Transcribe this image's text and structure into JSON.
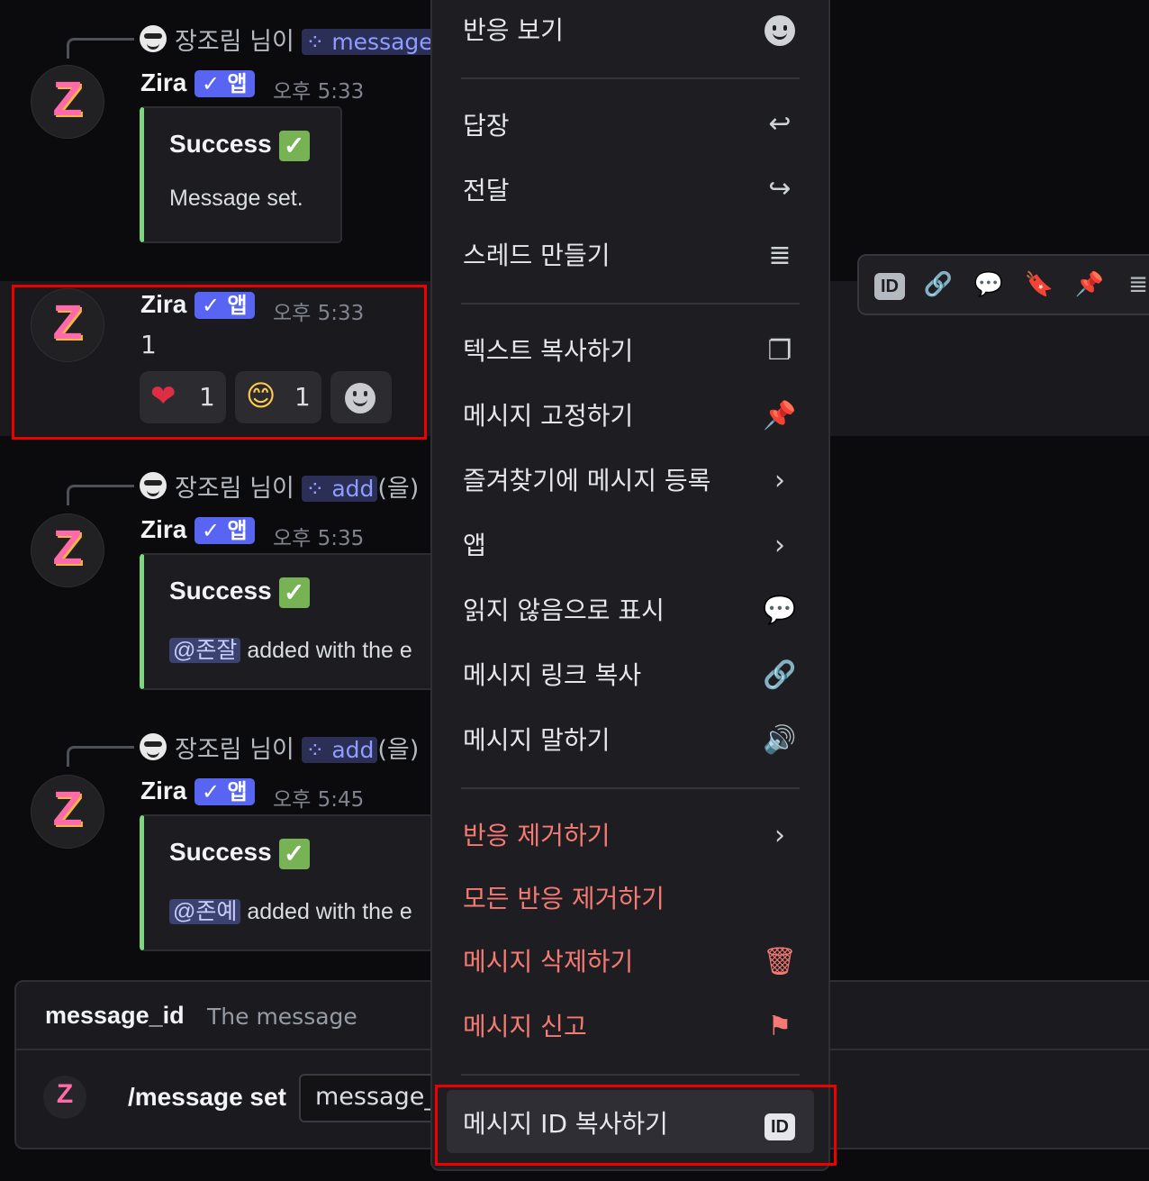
{
  "messages": [
    {
      "reply_user": "장조림",
      "reply_suffix": "님이",
      "reply_command": "message",
      "reply_tail": "",
      "author": "Zira",
      "app_badge": "앱",
      "time": "오후 5:33",
      "embed_title": "Success",
      "embed_desc": "Message set."
    },
    {
      "author": "Zira",
      "app_badge": "앱",
      "time": "오후 5:33",
      "content": "1",
      "reactions": [
        {
          "emoji": "❤",
          "count": "1"
        },
        {
          "emoji": "😊",
          "count": "1"
        }
      ]
    },
    {
      "reply_user": "장조림",
      "reply_suffix": "님이",
      "reply_command": "add",
      "reply_tail": "(을)",
      "author": "Zira",
      "app_badge": "앱",
      "time": "오후 5:35",
      "embed_title": "Success",
      "mention": "@존잘",
      "embed_desc": "added with the e"
    },
    {
      "reply_user": "장조림",
      "reply_suffix": "님이",
      "reply_command": "add",
      "reply_tail": "(을)",
      "author": "Zira",
      "app_badge": "앱",
      "time": "오후 5:45",
      "embed_title": "Success",
      "mention": "@존예",
      "embed_desc": "added with the e"
    }
  ],
  "slash": {
    "option_name": "message_id",
    "option_desc": "The message",
    "command": "/message set",
    "input_value": "message_"
  },
  "toolbar": {
    "icons": [
      "id-icon",
      "link-icon",
      "mark-unread-icon",
      "bookmark-icon",
      "pin-icon",
      "thread-icon"
    ],
    "id_label": "ID"
  },
  "menu": {
    "view_reactions": "반응 보기",
    "reply": "답장",
    "forward": "전달",
    "create_thread": "스레드 만들기",
    "copy_text": "텍스트 복사하기",
    "pin_message": "메시지 고정하기",
    "bookmark": "즐겨찾기에 메시지 등록",
    "apps": "앱",
    "mark_unread": "읽지 않음으로 표시",
    "copy_link": "메시지 링크 복사",
    "speak_message": "메시지 말하기",
    "remove_reaction": "반응 제거하기",
    "remove_all_reactions": "모든 반응 제거하기",
    "delete_message": "메시지 삭제하기",
    "report_message": "메시지 신고",
    "copy_id": "메시지 ID 복사하기",
    "id_label": "ID"
  },
  "colors": {
    "danger": "#f47a73",
    "accent": "#5865f2",
    "embed_bar": "#7ed77f",
    "highlight_box": "#e00000"
  }
}
